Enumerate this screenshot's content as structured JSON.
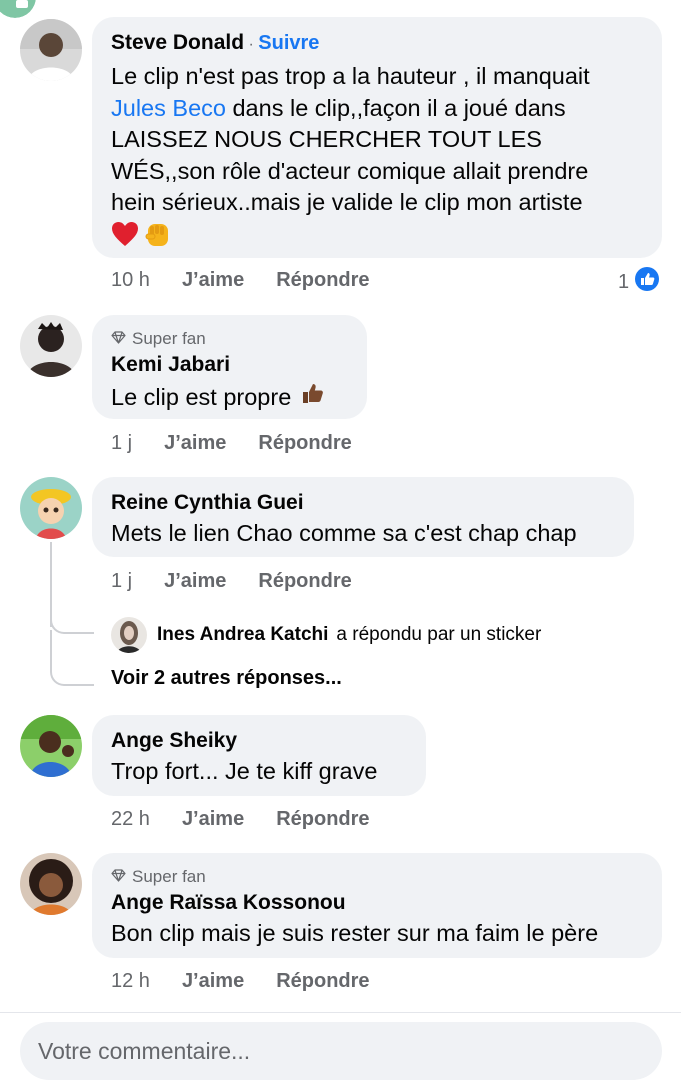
{
  "comments": [
    {
      "author": "Steve Donald",
      "follow_sep": "·",
      "follow_label": "Suivre",
      "text_part1": "Le clip n'est pas trop a la hauteur  , il manquait",
      "mention": "Jules Beco",
      "text_part2": " dans le clip,,façon il a joué  dans",
      "text_line3": "LAISSEZ NOUS CHERCHER TOUT LES",
      "text_line4": "WÉS,,son rôle d'acteur comique allait prendre",
      "text_line5": "hein sérieux..mais  je valide le clip mon artiste",
      "emojis": [
        "red-heart-icon",
        "raised-fist-icon"
      ],
      "time": "10 h",
      "like_label": "J’aime",
      "reply_label": "Répondre",
      "reaction_count": "1",
      "reaction_icon": "like-icon"
    },
    {
      "badge": "Super fan",
      "author": "Kemi Jabari",
      "text": "Le clip est propre",
      "emoji": "thumbs-up-icon",
      "time": "1 j",
      "like_label": "J’aime",
      "reply_label": "Répondre"
    },
    {
      "author": "Reine Cynthia Guei",
      "text": "Mets le lien Chao comme sa c'est chap chap",
      "time": "1 j",
      "like_label": "J’aime",
      "reply_label": "Répondre",
      "sticker_reply": {
        "author": "Ines Andrea Katchi",
        "text": "a répondu par un sticker"
      },
      "more_replies": "Voir 2 autres réponses..."
    },
    {
      "author": "Ange Sheiky",
      "text": "Trop fort... Je te kiff grave",
      "time": "22 h",
      "like_label": "J’aime",
      "reply_label": "Répondre"
    },
    {
      "badge": "Super fan",
      "author": "Ange Raïssa Kossonou",
      "text": "Bon clip mais je suis rester sur ma faim le père",
      "time": "12 h",
      "like_label": "J’aime",
      "reply_label": "Répondre"
    }
  ],
  "composer": {
    "placeholder": "Votre commentaire..."
  },
  "colors": {
    "bubble": "#f0f2f5",
    "link": "#1877f2",
    "muted": "#65676b",
    "text": "#050505"
  }
}
